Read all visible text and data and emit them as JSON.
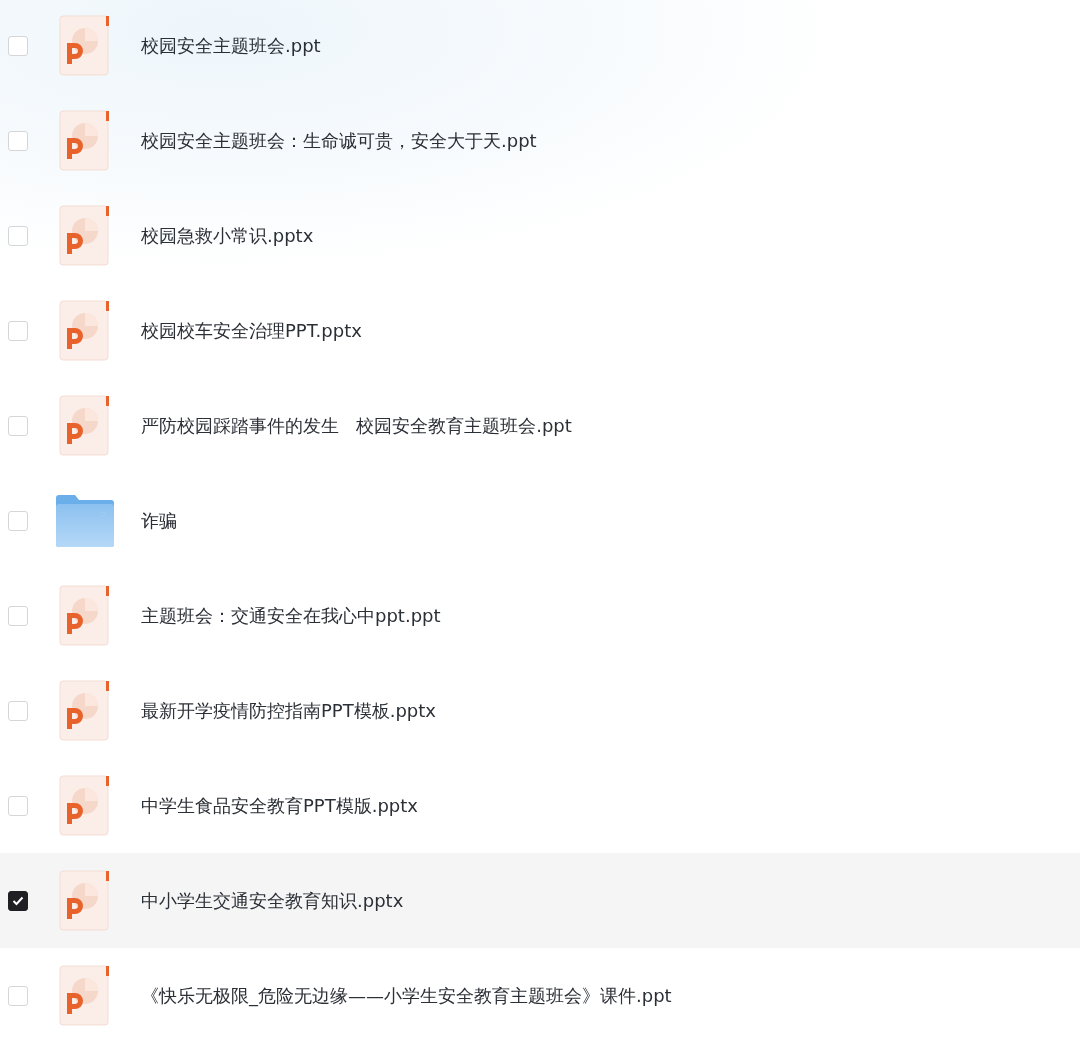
{
  "files": [
    {
      "kind": "ppt",
      "name": "校园安全主题班会.ppt",
      "selected": false
    },
    {
      "kind": "ppt",
      "name": "校园安全主题班会：生命诚可贵，安全大于天.ppt",
      "selected": false
    },
    {
      "kind": "ppt",
      "name": "校园急救小常识.pptx",
      "selected": false
    },
    {
      "kind": "ppt",
      "name": "校园校车安全治理PPT.pptx",
      "selected": false
    },
    {
      "kind": "ppt",
      "name": "严防校园踩踏事件的发生   校园安全教育主题班会.ppt",
      "selected": false
    },
    {
      "kind": "folder",
      "name": "诈骗",
      "selected": false
    },
    {
      "kind": "ppt",
      "name": "主题班会：交通安全在我心中ppt.ppt",
      "selected": false
    },
    {
      "kind": "ppt",
      "name": "最新开学疫情防控指南PPT模板.pptx",
      "selected": false
    },
    {
      "kind": "ppt",
      "name": "中学生食品安全教育PPT模版.pptx",
      "selected": false
    },
    {
      "kind": "ppt",
      "name": "中小学生交通安全教育知识.pptx",
      "selected": true
    },
    {
      "kind": "ppt",
      "name": "《快乐无极限_危险无边缘——小学生安全教育主题班会》课件.ppt",
      "selected": false
    }
  ]
}
